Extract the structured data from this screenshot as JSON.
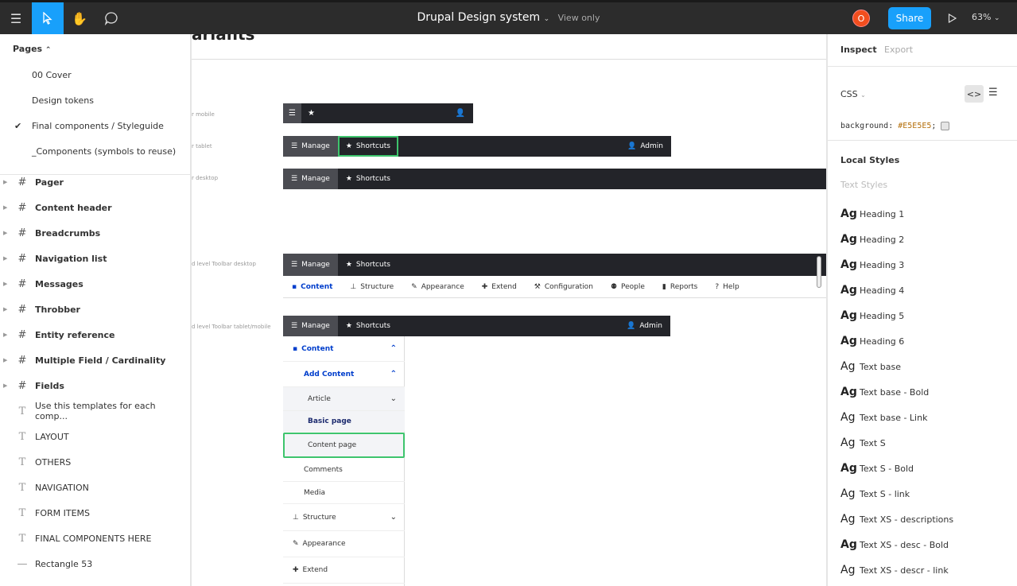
{
  "topbar": {
    "file_title": "Drupal Design system",
    "view_mode": "View only",
    "avatar_initial": "O",
    "share_label": "Share",
    "zoom": "63%"
  },
  "pages": {
    "header": "Pages",
    "items": [
      {
        "label": "00 Cover"
      },
      {
        "label": "Design tokens"
      },
      {
        "label": "Final components / Styleguide"
      },
      {
        "label": "_Components (symbols to reuse)"
      }
    ],
    "current_index": 2
  },
  "layers": [
    {
      "label": "Pager",
      "kind": "frame"
    },
    {
      "label": "Content header",
      "kind": "frame"
    },
    {
      "label": "Breadcrumbs",
      "kind": "frame"
    },
    {
      "label": "Navigation list",
      "kind": "frame"
    },
    {
      "label": "Messages",
      "kind": "frame"
    },
    {
      "label": "Throbber",
      "kind": "frame"
    },
    {
      "label": "Entity reference",
      "kind": "frame"
    },
    {
      "label": "Multiple Field / Cardinality",
      "kind": "frame"
    },
    {
      "label": "Fields",
      "kind": "frame"
    },
    {
      "label": "Use this templates for each comp...",
      "kind": "text"
    },
    {
      "label": "LAYOUT",
      "kind": "text"
    },
    {
      "label": "OTHERS",
      "kind": "text"
    },
    {
      "label": "NAVIGATION",
      "kind": "text"
    },
    {
      "label": "FORM ITEMS",
      "kind": "text"
    },
    {
      "label": "FINAL COMPONENTS HERE",
      "kind": "text"
    },
    {
      "label": "Rectangle 53",
      "kind": "rect"
    }
  ],
  "canvas": {
    "clipped_heading": "ariants",
    "labels": {
      "mobile": "r mobile",
      "tablet": "r tablet",
      "desktop": "r desktop",
      "second_desktop": "d level Toolbar desktop",
      "second_tablet": "d level Toolbar tablet/mobile"
    },
    "toolbar": {
      "manage": "Manage",
      "shortcuts": "Shortcuts",
      "admin": "Admin"
    },
    "tray_items": [
      {
        "label": "Content",
        "icon": "file-icon",
        "glyph": "▪",
        "active": true
      },
      {
        "label": "Structure",
        "icon": "structure-icon",
        "glyph": "⊥",
        "active": false
      },
      {
        "label": "Appearance",
        "icon": "brush-icon",
        "glyph": "✎",
        "active": false
      },
      {
        "label": "Extend",
        "icon": "puzzle-icon",
        "glyph": "✚",
        "active": false
      },
      {
        "label": "Configuration",
        "icon": "wrench-icon",
        "glyph": "⚒",
        "active": false
      },
      {
        "label": "People",
        "icon": "people-icon",
        "glyph": "⚉",
        "active": false
      },
      {
        "label": "Reports",
        "icon": "bar-chart-icon",
        "glyph": "▮",
        "active": false
      },
      {
        "label": "Help",
        "icon": "help-icon",
        "glyph": "?",
        "active": false
      }
    ],
    "vertical_menu": {
      "content": "Content",
      "add_content": "Add Content",
      "article": "Article",
      "basic_page": "Basic page",
      "content_page": "Content page",
      "comments": "Comments",
      "media": "Media",
      "structure": "Structure",
      "appearance": "Appearance",
      "extend": "Extend"
    }
  },
  "inspect": {
    "tab_inspect": "Inspect",
    "tab_export": "Export",
    "css_label": "CSS",
    "code_property": "background: ",
    "code_value": "#E5E5E5",
    "code_end": ";",
    "local_styles": "Local Styles",
    "text_styles": "Text Styles",
    "styles": [
      {
        "name": "Heading 1",
        "bold": true
      },
      {
        "name": "Heading 2",
        "bold": true
      },
      {
        "name": "Heading 3",
        "bold": true
      },
      {
        "name": "Heading 4",
        "bold": true
      },
      {
        "name": "Heading 5",
        "bold": true
      },
      {
        "name": "Heading 6",
        "bold": true
      },
      {
        "name": "Text base",
        "bold": false
      },
      {
        "name": "Text base - Bold",
        "bold": true
      },
      {
        "name": "Text base - Link",
        "bold": false
      },
      {
        "name": "Text S",
        "bold": false
      },
      {
        "name": "Text S - Bold",
        "bold": true
      },
      {
        "name": "Text S - link",
        "bold": false
      },
      {
        "name": "Text XS - descriptions",
        "bold": false
      },
      {
        "name": "Text XS - desc - Bold",
        "bold": true
      },
      {
        "name": "Text XS - descr - link",
        "bold": false
      }
    ],
    "style_sample": "Ag"
  },
  "colors": {
    "topbar": "#2c2c2c",
    "accent": "#18a0fb",
    "selection_green": "#3ec46d",
    "drupal_blue": "#003ecc",
    "toolbar_dark": "#232429"
  }
}
